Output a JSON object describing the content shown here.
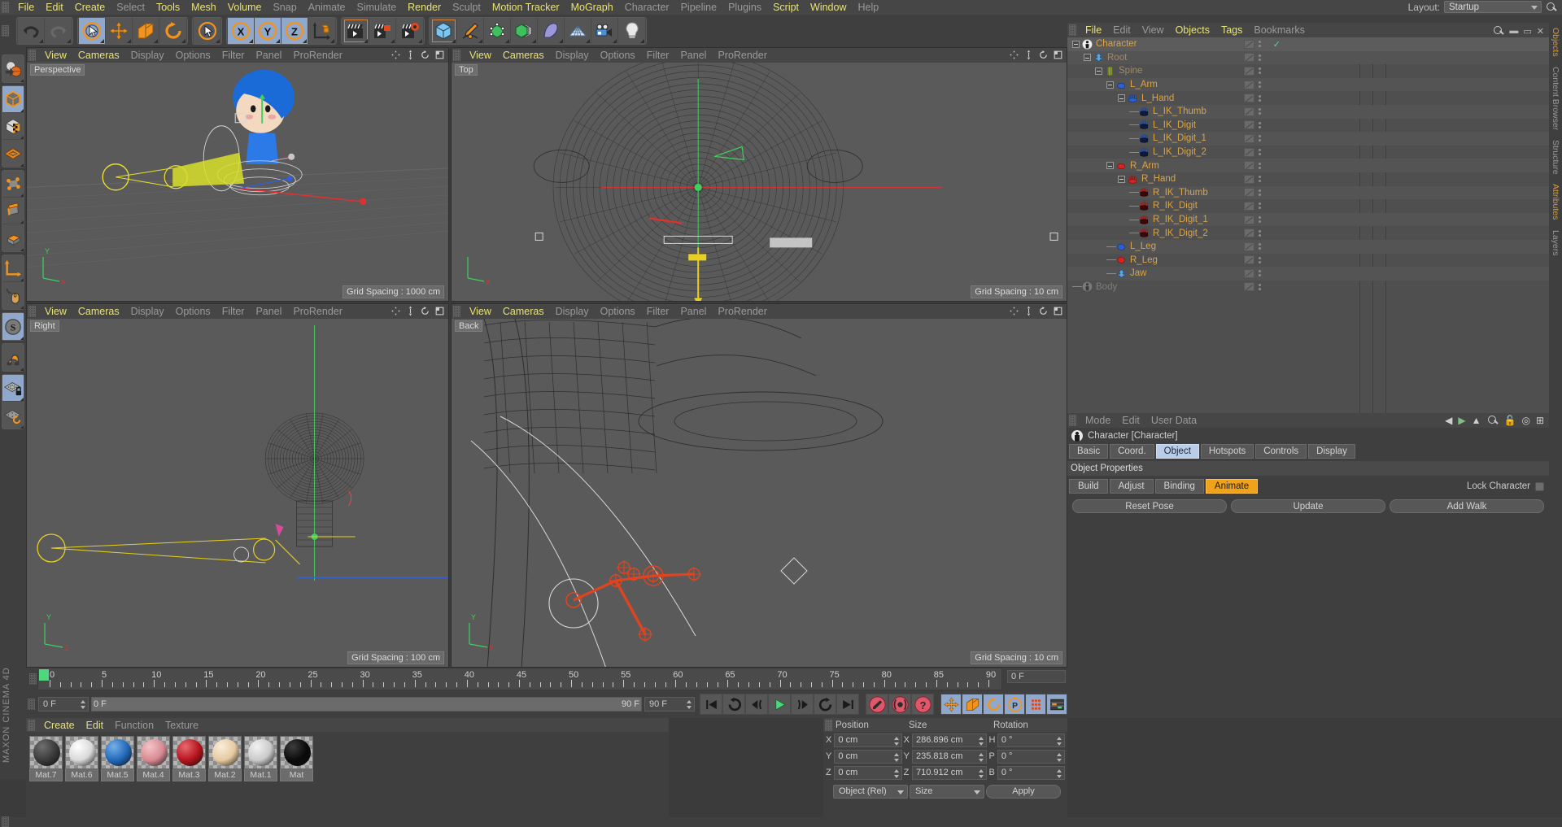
{
  "app": {
    "brand": "MAXON CINEMA 4D"
  },
  "menubar": {
    "items": [
      {
        "label": "File",
        "hl": true
      },
      {
        "label": "Edit",
        "hl": true
      },
      {
        "label": "Create",
        "hl": true
      },
      {
        "label": "Select",
        "hl": false
      },
      {
        "label": "Tools",
        "hl": true
      },
      {
        "label": "Mesh",
        "hl": true
      },
      {
        "label": "Volume",
        "hl": true
      },
      {
        "label": "Snap",
        "hl": false
      },
      {
        "label": "Animate",
        "hl": false
      },
      {
        "label": "Simulate",
        "hl": false
      },
      {
        "label": "Render",
        "hl": true
      },
      {
        "label": "Sculpt",
        "hl": false
      },
      {
        "label": "Motion Tracker",
        "hl": true
      },
      {
        "label": "MoGraph",
        "hl": true
      },
      {
        "label": "Character",
        "hl": false
      },
      {
        "label": "Pipeline",
        "hl": false
      },
      {
        "label": "Plugins",
        "hl": false
      },
      {
        "label": "Script",
        "hl": true
      },
      {
        "label": "Window",
        "hl": true
      },
      {
        "label": "Help",
        "hl": false
      }
    ],
    "layout_label": "Layout:",
    "layout_value": "Startup",
    "search_icon": "search-icon"
  },
  "toolbar": {
    "groups": [
      {
        "buttons": [
          {
            "name": "undo-button",
            "icon": "undo-icon",
            "state": "normal"
          },
          {
            "name": "redo-button",
            "icon": "redo-icon",
            "state": "disabled"
          }
        ]
      },
      {
        "buttons": [
          {
            "name": "live-selection-tool",
            "icon": "cursor-circle-icon",
            "state": "on"
          },
          {
            "name": "move-tool",
            "icon": "move-arrows-icon",
            "state": "normal"
          },
          {
            "name": "scale-tool",
            "icon": "scale-box-icon",
            "state": "normal"
          },
          {
            "name": "rotate-tool",
            "icon": "rotate-icon",
            "state": "normal"
          }
        ]
      },
      {
        "buttons": [
          {
            "name": "select-tool",
            "icon": "cursor-circle-icon",
            "state": "normal"
          }
        ]
      },
      {
        "buttons": [
          {
            "name": "x-axis-lock",
            "icon": "x-axis-icon",
            "state": "on"
          },
          {
            "name": "y-axis-lock",
            "icon": "y-axis-icon",
            "state": "on"
          },
          {
            "name": "z-axis-lock",
            "icon": "z-axis-icon",
            "state": "on"
          },
          {
            "name": "world-object-axis",
            "icon": "axis-cube-icon",
            "state": "normal"
          }
        ]
      },
      {
        "buttons": [
          {
            "name": "render-view-button",
            "icon": "clapper-icon",
            "state": "selected"
          },
          {
            "name": "render-region-button",
            "icon": "clapper-region-icon",
            "state": "normal"
          },
          {
            "name": "render-settings-button",
            "icon": "clapper-gear-icon",
            "state": "yellow"
          }
        ]
      },
      {
        "buttons": [
          {
            "name": "add-cube-button",
            "icon": "cube-icon",
            "state": "selected"
          },
          {
            "name": "add-spline-button",
            "icon": "pen-icon",
            "state": "normal"
          },
          {
            "name": "add-generator-button",
            "icon": "generator-icon",
            "state": "normal"
          },
          {
            "name": "add-array-button",
            "icon": "array-icon",
            "state": "yellow"
          },
          {
            "name": "add-deformer-button",
            "icon": "bend-icon",
            "state": "normal"
          },
          {
            "name": "add-scene-button",
            "icon": "floor-icon",
            "state": "normal"
          },
          {
            "name": "add-camera-button",
            "icon": "camera-icon",
            "state": "normal"
          },
          {
            "name": "add-light-button",
            "icon": "light-bulb-icon",
            "state": "normal"
          }
        ]
      }
    ]
  },
  "left_toolbar": {
    "groups": [
      {
        "buttons": [
          {
            "name": "undo-view-tool",
            "icon": "sphere-undo-icon",
            "state": "normal"
          }
        ]
      },
      {
        "buttons": [
          {
            "name": "model-mode-tool",
            "icon": "model-cube-icon",
            "state": "on"
          },
          {
            "name": "texture-mode-tool",
            "icon": "texture-cube-icon",
            "state": "normal"
          },
          {
            "name": "workplane-tool",
            "icon": "workplane-icon",
            "state": "normal"
          }
        ]
      },
      {
        "buttons": [
          {
            "name": "points-mode-tool",
            "icon": "points-icon",
            "state": "normal"
          },
          {
            "name": "edges-mode-tool",
            "icon": "edges-icon",
            "state": "normal"
          },
          {
            "name": "polygons-mode-tool",
            "icon": "polygons-icon",
            "state": "normal"
          }
        ]
      },
      {
        "buttons": [
          {
            "name": "axis-mode-tool",
            "icon": "axis-icon",
            "state": "normal"
          },
          {
            "name": "enable-snap-tool",
            "icon": "mouse-icon",
            "state": "normal"
          }
        ]
      },
      {
        "buttons": [
          {
            "name": "soft-selection-tool",
            "icon": "s-circle-icon",
            "state": "on"
          }
        ]
      },
      {
        "buttons": [
          {
            "name": "magnet-tool",
            "icon": "magnet-icon",
            "state": "normal"
          }
        ]
      },
      {
        "buttons": [
          {
            "name": "lock-workplane-tool",
            "icon": "workplane-lock-icon",
            "state": "on"
          },
          {
            "name": "workplane-rotate-tool",
            "icon": "workplane-rotate-icon",
            "state": "normal"
          }
        ]
      }
    ]
  },
  "viewport_menu": [
    "View",
    "Cameras",
    "Display",
    "Options",
    "Filter",
    "Panel",
    "ProRender"
  ],
  "viewports": [
    {
      "name": "viewport-perspective",
      "label": "Perspective",
      "grid_spacing": "Grid Spacing : 1000 cm"
    },
    {
      "name": "viewport-top",
      "label": "Top",
      "grid_spacing": "Grid Spacing : 10 cm"
    },
    {
      "name": "viewport-right",
      "label": "Right",
      "grid_spacing": "Grid Spacing : 100 cm"
    },
    {
      "name": "viewport-back",
      "label": "Back",
      "grid_spacing": "Grid Spacing : 10 cm"
    }
  ],
  "timeline": {
    "ticks": [
      0,
      5,
      10,
      15,
      20,
      25,
      30,
      35,
      40,
      45,
      50,
      55,
      60,
      65,
      70,
      75,
      80,
      85,
      90
    ],
    "current_frame_field": "0 F",
    "start_field": "0 F",
    "end_field": "90 F",
    "scrub_left": "0 F",
    "scrub_right": "90 F",
    "playhead_frame": 0
  },
  "transport": {
    "buttons": [
      {
        "name": "goto-start-button",
        "icon": "skip-start-icon"
      },
      {
        "name": "step-back-keyframe-button",
        "icon": "prev-key-icon"
      },
      {
        "name": "step-back-frame-button",
        "icon": "prev-frame-icon"
      },
      {
        "name": "play-button",
        "icon": "play-icon"
      },
      {
        "name": "step-forward-frame-button",
        "icon": "next-frame-icon"
      },
      {
        "name": "step-forward-keyframe-button",
        "icon": "next-key-icon"
      },
      {
        "name": "goto-end-button",
        "icon": "skip-end-icon"
      }
    ],
    "record_buttons": [
      {
        "name": "record-active-objects-button",
        "icon": "record-key-icon"
      },
      {
        "name": "autokeying-button",
        "icon": "autokey-icon"
      },
      {
        "name": "keyframe-selection-button",
        "icon": "question-icon"
      }
    ],
    "key_toggles": [
      {
        "name": "position-key-toggle",
        "icon": "move-arrows-icon"
      },
      {
        "name": "scale-key-toggle",
        "icon": "scale-box-icon"
      },
      {
        "name": "rotation-key-toggle",
        "icon": "rotate-icon"
      },
      {
        "name": "pla-key-toggle",
        "icon": "p-circle-icon"
      },
      {
        "name": "parameter-key-toggle",
        "icon": "dots-grid-icon"
      },
      {
        "name": "point-level-anim-toggle",
        "icon": "timeline-icon"
      }
    ]
  },
  "material_manager": {
    "menu": [
      "Create",
      "Edit",
      "Function",
      "Texture"
    ],
    "materials": [
      {
        "name": "Mat.7",
        "color": "#3a3a3a",
        "hi": "#6f6f6f"
      },
      {
        "name": "Mat.6",
        "color": "#d8d8d8",
        "hi": "#ffffff"
      },
      {
        "name": "Mat.5",
        "color": "#2268b8",
        "hi": "#76b0e8"
      },
      {
        "name": "Mat.4",
        "color": "#d68a92",
        "hi": "#f4c3c7"
      },
      {
        "name": "Mat.3",
        "color": "#b4141c",
        "hi": "#e86a70"
      },
      {
        "name": "Mat.2",
        "color": "#e6c9a0",
        "hi": "#fbeedb"
      },
      {
        "name": "Mat.1",
        "color": "#c9c9c9",
        "hi": "#f2f2f2"
      },
      {
        "name": "Mat",
        "color": "#0a0a0a",
        "hi": "#3d3d3d"
      }
    ]
  },
  "coordinates": {
    "headers": [
      "Position",
      "Size",
      "Rotation"
    ],
    "rows": [
      {
        "l1": "X",
        "v1": "0 cm",
        "l2": "X",
        "v2": "286.896 cm",
        "l3": "H",
        "v3": "0 °"
      },
      {
        "l1": "Y",
        "v1": "0 cm",
        "l2": "Y",
        "v2": "235.818 cm",
        "l3": "P",
        "v3": "0 °"
      },
      {
        "l1": "Z",
        "v1": "0 cm",
        "l2": "Z",
        "v2": "710.912 cm",
        "l3": "B",
        "v3": "0 °"
      }
    ],
    "mode_select": "Object (Rel)",
    "size_select": "Size",
    "apply_button": "Apply"
  },
  "object_manager": {
    "menu": [
      "File",
      "Edit",
      "View",
      "Objects",
      "Tags",
      "Bookmarks"
    ],
    "menu_hl": [
      true,
      false,
      false,
      true,
      true,
      false
    ],
    "tree": [
      {
        "label": "Character",
        "depth": 0,
        "icon": "character-icon",
        "color": "#d9a44a",
        "expander": true,
        "check": true
      },
      {
        "label": "Root",
        "depth": 1,
        "icon": "puzzle-icon",
        "color": "#b89a6a",
        "expander": true,
        "check": false
      },
      {
        "label": "Spine",
        "depth": 2,
        "icon": "spine-icon",
        "color": "#b89a6a",
        "expander": true,
        "check": false
      },
      {
        "label": "L_Arm",
        "depth": 3,
        "icon": "arm-blue-icon",
        "color": "#d9a44a",
        "expander": true,
        "check": false
      },
      {
        "label": "L_Hand",
        "depth": 4,
        "icon": "hand-blue-icon",
        "color": "#d9a44a",
        "expander": true,
        "check": false
      },
      {
        "label": "L_IK_Thumb",
        "depth": 5,
        "icon": "hand-darkblue-icon",
        "color": "#d9a44a",
        "expander": false,
        "check": false
      },
      {
        "label": "L_IK_Digit",
        "depth": 5,
        "icon": "hand-darkblue-icon",
        "color": "#d9a44a",
        "expander": false,
        "check": false
      },
      {
        "label": "L_IK_Digit_1",
        "depth": 5,
        "icon": "hand-darkblue-icon",
        "color": "#d9a44a",
        "expander": false,
        "check": false
      },
      {
        "label": "L_IK_Digit_2",
        "depth": 5,
        "icon": "hand-darkblue-icon",
        "color": "#d9a44a",
        "expander": false,
        "check": false
      },
      {
        "label": "R_Arm",
        "depth": 3,
        "icon": "arm-red-icon",
        "color": "#d9a44a",
        "expander": true,
        "check": false
      },
      {
        "label": "R_Hand",
        "depth": 4,
        "icon": "hand-red-icon",
        "color": "#d9a44a",
        "expander": true,
        "check": false
      },
      {
        "label": "R_IK_Thumb",
        "depth": 5,
        "icon": "hand-darkred-icon",
        "color": "#d9a44a",
        "expander": false,
        "check": false
      },
      {
        "label": "R_IK_Digit",
        "depth": 5,
        "icon": "hand-darkred-icon",
        "color": "#d9a44a",
        "expander": false,
        "check": false
      },
      {
        "label": "R_IK_Digit_1",
        "depth": 5,
        "icon": "hand-darkred-icon",
        "color": "#d9a44a",
        "expander": false,
        "check": false
      },
      {
        "label": "R_IK_Digit_2",
        "depth": 5,
        "icon": "hand-darkred-icon",
        "color": "#d9a44a",
        "expander": false,
        "check": false
      },
      {
        "label": "L_Leg",
        "depth": 3,
        "icon": "leg-blue-icon",
        "color": "#d9a44a",
        "expander": false,
        "check": false
      },
      {
        "label": "R_Leg",
        "depth": 3,
        "icon": "leg-red-icon",
        "color": "#d9a44a",
        "expander": false,
        "check": false
      },
      {
        "label": "Jaw",
        "depth": 3,
        "icon": "puzzle-icon",
        "color": "#d9a44a",
        "expander": false,
        "check": false
      },
      {
        "label": "Body",
        "depth": 0,
        "icon": "figure-icon",
        "color": "#7e7e7e",
        "expander": false,
        "check": false
      }
    ]
  },
  "attributes": {
    "menu": [
      "Mode",
      "Edit",
      "User Data"
    ],
    "object_title": "Character [Character]",
    "tabs": [
      "Basic",
      "Coord.",
      "Object",
      "Hotspots",
      "Controls",
      "Display"
    ],
    "active_tab": "Object",
    "section_title": "Object Properties",
    "mode_buttons": [
      "Build",
      "Adjust",
      "Binding",
      "Animate"
    ],
    "active_mode": "Animate",
    "lock_label": "Lock Character",
    "wide_buttons": [
      "Reset Pose",
      "Update",
      "Add Walk"
    ]
  },
  "vertical_tabs": [
    {
      "label": "Objects",
      "active": true
    },
    {
      "label": "Content Browser",
      "active": false
    },
    {
      "label": "Structure",
      "active": false
    },
    {
      "label": "Attributes",
      "active": true
    },
    {
      "label": "Layers",
      "active": false
    }
  ]
}
